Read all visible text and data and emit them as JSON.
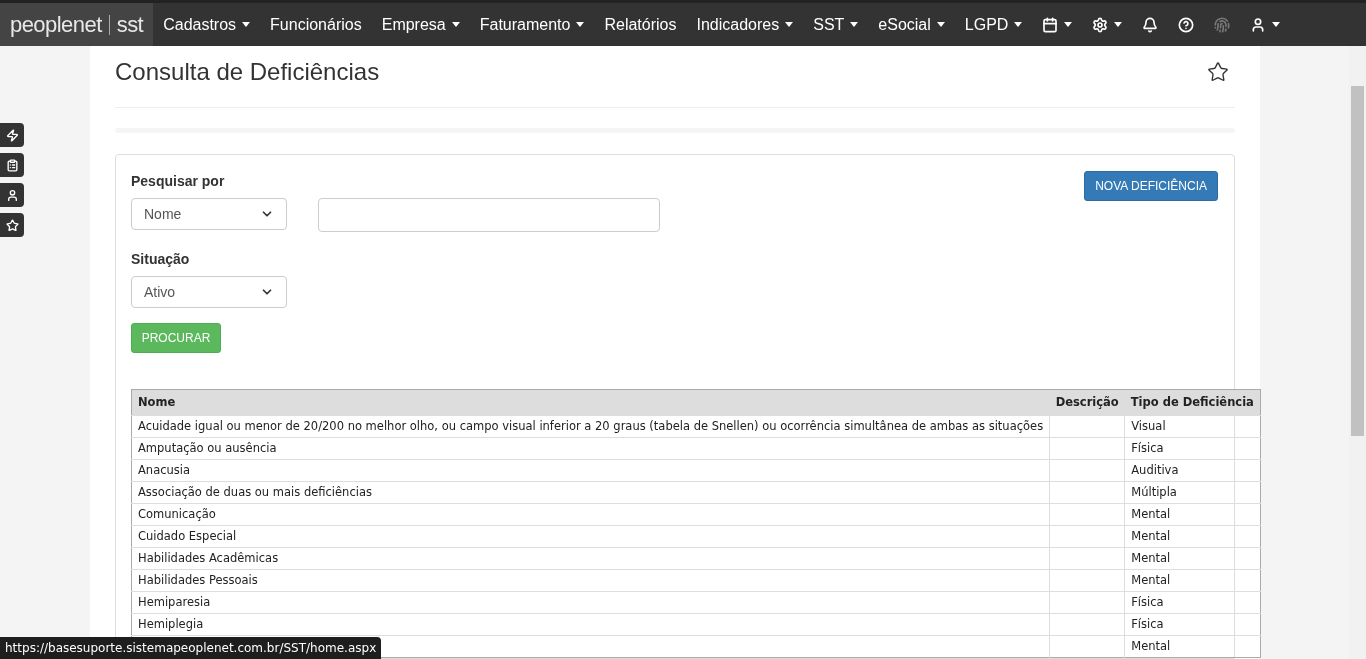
{
  "brand": {
    "name": "peoplenet",
    "product": "sst"
  },
  "nav": [
    {
      "label": "Cadastros",
      "caret": true
    },
    {
      "label": "Funcionários",
      "caret": false
    },
    {
      "label": "Empresa",
      "caret": true
    },
    {
      "label": "Faturamento",
      "caret": true
    },
    {
      "label": "Relatórios",
      "caret": false
    },
    {
      "label": "Indicadores",
      "caret": true
    },
    {
      "label": "SST",
      "caret": true
    },
    {
      "label": "eSocial",
      "caret": true
    },
    {
      "label": "LGPD",
      "caret": true
    }
  ],
  "nav_icons": [
    {
      "caret": true,
      "disabled": false
    },
    {
      "caret": true,
      "disabled": false
    },
    {
      "caret": false,
      "disabled": false
    },
    {
      "caret": false,
      "disabled": false
    },
    {
      "caret": false,
      "disabled": true
    },
    {
      "caret": true,
      "disabled": false
    }
  ],
  "page_title": "Consulta de Deficiências",
  "search": {
    "label": "Pesquisar por",
    "select_value": "Nome"
  },
  "status_filter": {
    "label": "Situação",
    "select_value": "Ativo"
  },
  "buttons": {
    "search": "PROCURAR",
    "new": "NOVA DEFICIÊNCIA"
  },
  "table": {
    "columns": [
      "Nome",
      "Descrição",
      "Tipo de Deficiência"
    ],
    "rows": [
      {
        "nome": "Acuidade igual ou menor de 20/200 no melhor olho, ou campo visual inferior a 20 graus (tabela de Snellen) ou ocorrência simultânea de ambas as situações",
        "tipo": "Visual"
      },
      {
        "nome": "Amputação ou ausência",
        "tipo": "Física"
      },
      {
        "nome": "Anacusia",
        "tipo": "Auditiva"
      },
      {
        "nome": "Associação de duas ou mais deficiências",
        "tipo": "Múltipla"
      },
      {
        "nome": "Comunicação",
        "tipo": "Mental"
      },
      {
        "nome": "Cuidado Especial",
        "tipo": "Mental"
      },
      {
        "nome": "Habilidades Acadêmicas",
        "tipo": "Mental"
      },
      {
        "nome": "Habilidades Pessoais",
        "tipo": "Mental"
      },
      {
        "nome": "Hemiparesia",
        "tipo": "Física"
      },
      {
        "nome": "Hemiplegia",
        "tipo": "Física"
      },
      {
        "tipo": "Mental"
      }
    ]
  },
  "status_url": "https://basesuporte.sistemapeoplenet.com.br/SST/home.aspx"
}
